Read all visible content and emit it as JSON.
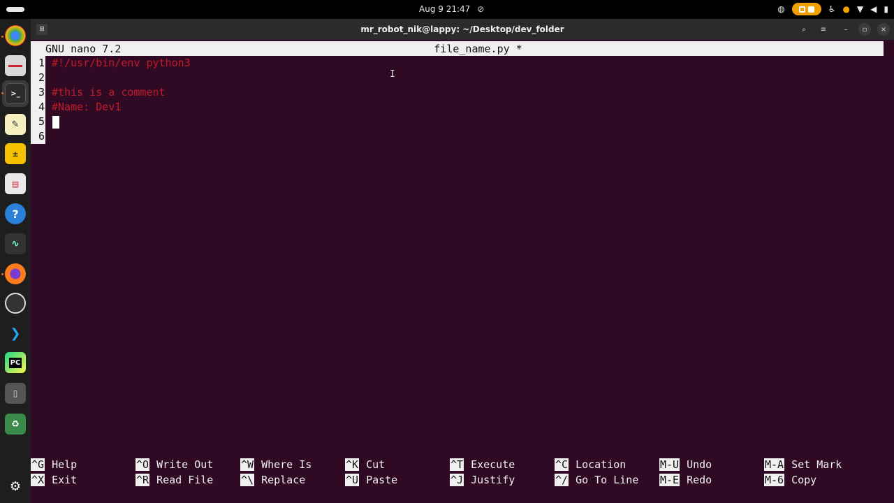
{
  "topbar": {
    "datetime": "Aug 9  21:47",
    "notif_icon": "bell-off-icon"
  },
  "window": {
    "title": "mr_robot_nik@lappy: ~/Desktop/dev_folder"
  },
  "nano": {
    "version": "GNU nano 7.2",
    "filename": "file_name.py *",
    "lines": [
      {
        "num": "1",
        "text": "#!/usr/bin/env python3"
      },
      {
        "num": "2",
        "text": ""
      },
      {
        "num": "3",
        "text": "#this is a comment"
      },
      {
        "num": "4",
        "text": "#Name: Dev1"
      },
      {
        "num": "5",
        "text": ""
      },
      {
        "num": "6",
        "text": ""
      }
    ],
    "shortcuts": [
      {
        "key": "^G",
        "label": "Help"
      },
      {
        "key": "^X",
        "label": "Exit"
      },
      {
        "key": "^O",
        "label": "Write Out"
      },
      {
        "key": "^R",
        "label": "Read File"
      },
      {
        "key": "^W",
        "label": "Where Is"
      },
      {
        "key": "^\\",
        "label": "Replace"
      },
      {
        "key": "^K",
        "label": "Cut"
      },
      {
        "key": "^U",
        "label": "Paste"
      },
      {
        "key": "^T",
        "label": "Execute"
      },
      {
        "key": "^J",
        "label": "Justify"
      },
      {
        "key": "^C",
        "label": "Location"
      },
      {
        "key": "^/",
        "label": "Go To Line"
      },
      {
        "key": "M-U",
        "label": "Undo"
      },
      {
        "key": "M-E",
        "label": "Redo"
      },
      {
        "key": "M-A",
        "label": "Set Mark"
      },
      {
        "key": "M-6",
        "label": "Copy"
      }
    ]
  },
  "dock": {
    "apps": [
      "chrome-icon",
      "files-icon",
      "terminal-icon",
      "text-editor-icon",
      "calculator-icon",
      "document-viewer-icon",
      "help-icon",
      "system-monitor-icon",
      "firefox-icon",
      "obs-icon",
      "vscode-icon",
      "pycharm-icon",
      "usb-drive-icon",
      "trash-icon",
      "show-apps-icon"
    ],
    "pycharm_label": "PC"
  },
  "colors": {
    "terminal_bg": "#300a24",
    "comment_red": "#c01c28",
    "accent_orange": "#f0a000"
  }
}
